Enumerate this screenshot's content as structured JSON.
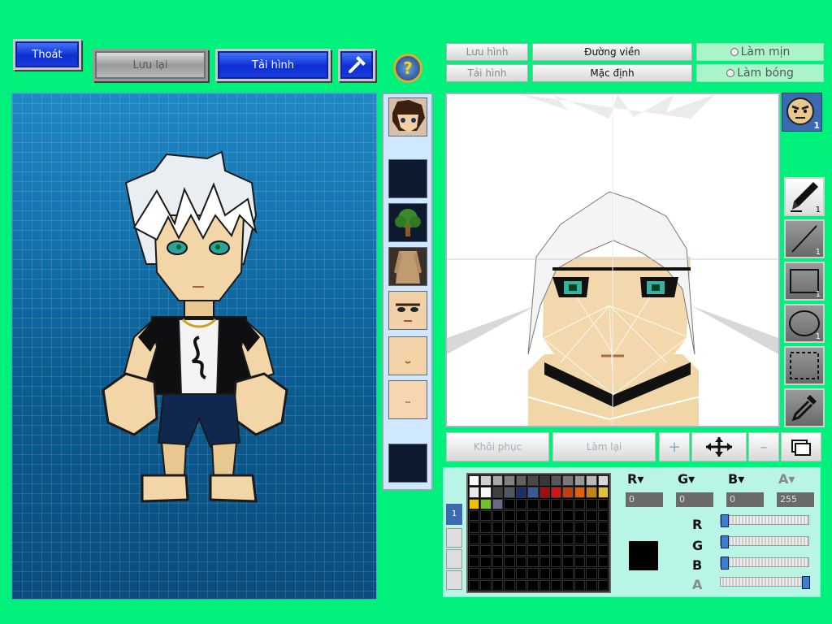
{
  "topbar": {
    "exit_label": "Thoát",
    "save_label": "Lưu lại",
    "load_label": "Tải hình"
  },
  "editor_toolbar": {
    "save_image_label": "Lưu hình",
    "outline_label": "Đường viền",
    "smooth_label": "Làm mịn",
    "load_image_label": "Tải hình",
    "default_label": "Mặc định",
    "shade_label": "Làm bóng"
  },
  "right_tools": {
    "pencil_count": "1",
    "line_count": "1",
    "rect_count": "1",
    "ellipse_count": "1",
    "face_badge": "1"
  },
  "bottom_toolbar": {
    "restore_label": "Khôi phục",
    "redo_label": "Làm lại"
  },
  "palette": {
    "tab_index": "1",
    "colors": [
      "#ffffff",
      "#d0d0d0",
      "#a8a8a8",
      "#808080",
      "#606060",
      "#484848",
      "#383838",
      "#585858",
      "#787878",
      "#989898",
      "#b8b8b8",
      "#d8d8d8",
      "#e8e8e8",
      "#f8f8f8",
      "#404040",
      "#505860",
      "#1a2f6a",
      "#3a5a9a",
      "#a01010",
      "#d01818",
      "#c04010",
      "#e06010",
      "#c08020",
      "#e0c040",
      "#f0c000",
      "#70c030",
      "#686888"
    ],
    "current_color": "#000000"
  },
  "channels": {
    "r_value": "0",
    "g_value": "0",
    "b_value": "0",
    "a_value": "255",
    "r_level": 0,
    "g_level": 0,
    "b_level": 0,
    "a_level": 1
  }
}
